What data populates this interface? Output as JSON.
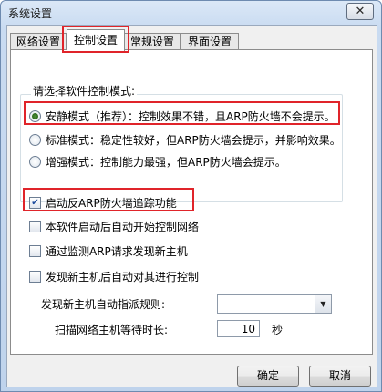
{
  "window": {
    "title": "系统设置",
    "close_label": "✕"
  },
  "tabs": [
    {
      "label": "网络设置"
    },
    {
      "label": "控制设置"
    },
    {
      "label": "常规设置"
    },
    {
      "label": "界面设置"
    }
  ],
  "mode_group": {
    "label": "请选择软件控制模式:",
    "options": [
      {
        "label": "安静模式（推荐）：控制效果不错，且ARP防火墙不会提示。",
        "checked": true
      },
      {
        "label": "标准模式：稳定性较好，但ARP防火墙会提示，并影响效果。",
        "checked": false
      },
      {
        "label": "增强模式：控制能力最强，但ARP防火墙会提示。",
        "checked": false
      }
    ]
  },
  "checkboxes": [
    {
      "label": "启动反ARP防火墙追踪功能",
      "checked": true
    },
    {
      "label": "本软件启动后自动开始控制网络",
      "checked": false
    },
    {
      "label": "通过监测ARP请求发现新主机",
      "checked": false
    },
    {
      "label": "发现新主机后自动对其进行控制",
      "checked": false
    }
  ],
  "settings": {
    "rule_label": "发现新主机自动指派规则:",
    "rule_value": "",
    "wait_label": "扫描网络主机等待时长:",
    "wait_value": "10",
    "wait_unit": "秒"
  },
  "buttons": {
    "ok": "确定",
    "cancel": "取消"
  }
}
